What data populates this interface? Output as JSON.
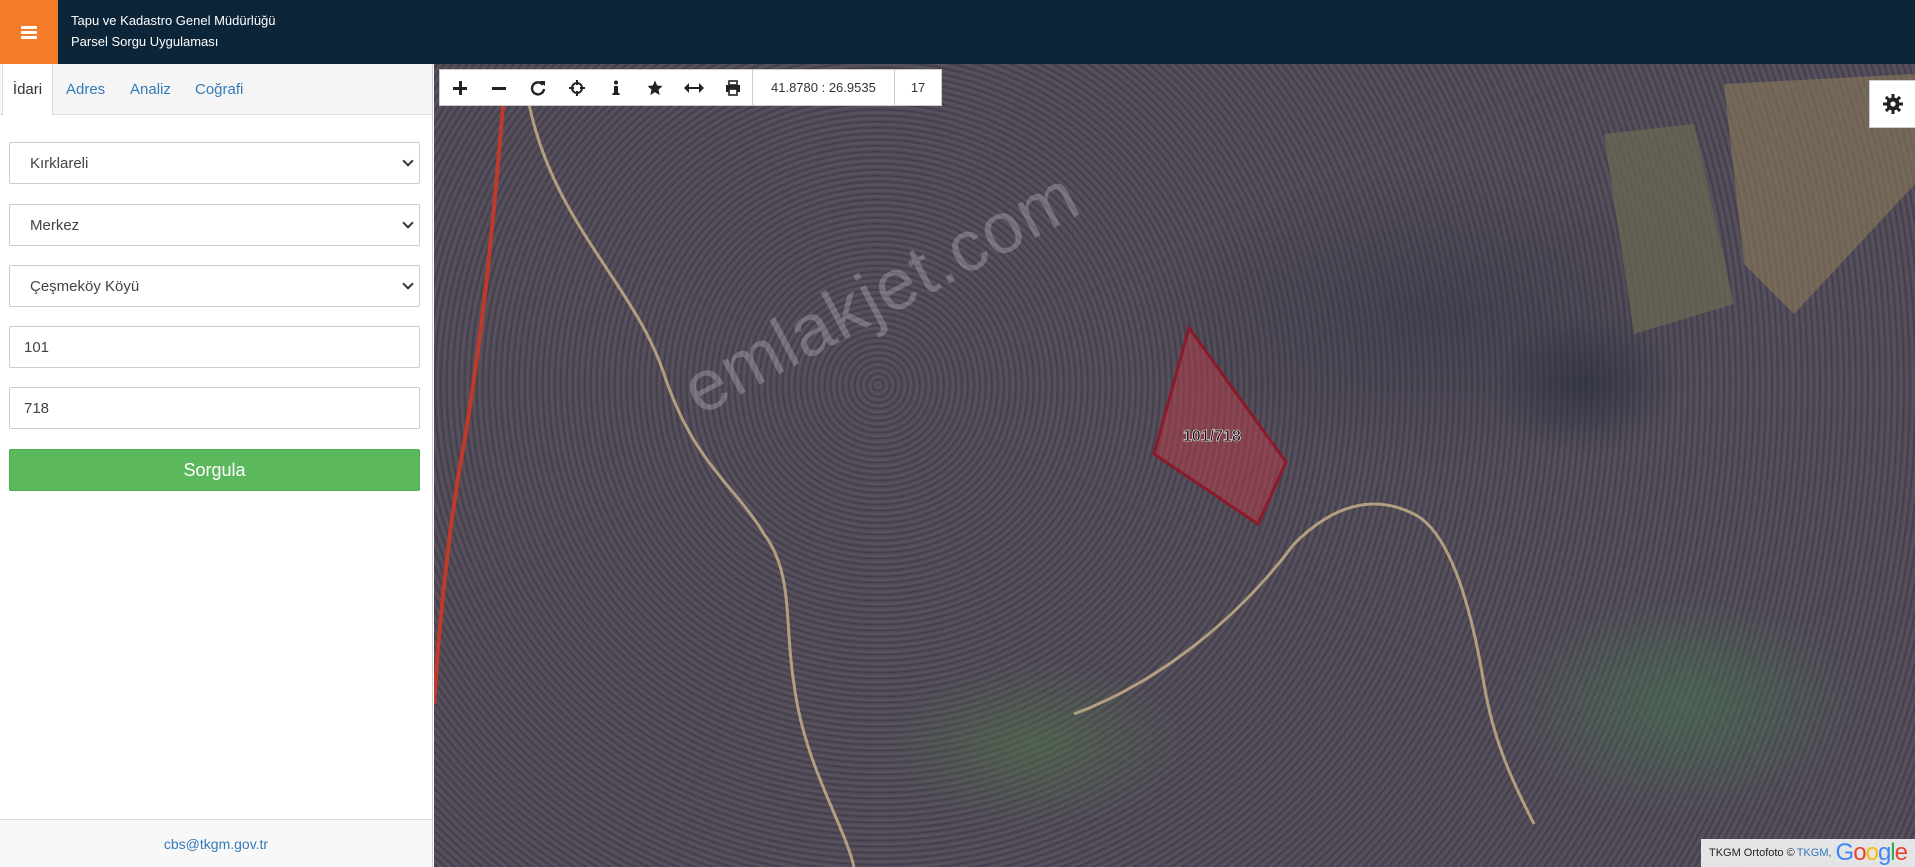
{
  "header": {
    "title_line1": "Tapu ve Kadastro Genel Müdürlüğü",
    "title_line2": "Parsel Sorgu Uygulaması"
  },
  "sidebar": {
    "tabs": [
      "İdari",
      "Adres",
      "Analiz",
      "Coğrafi"
    ],
    "active_tab": "İdari",
    "province": "Kırklareli",
    "district": "Merkez",
    "neighborhood": "Çeşmeköy Köyü",
    "block": "101",
    "parcel": "718",
    "query_button": "Sorgula",
    "footer_email": "cbs@tkgm.gov.tr"
  },
  "toolbar": {
    "icons": [
      "plus-icon",
      "minus-icon",
      "refresh-icon",
      "crosshair-icon",
      "info-icon",
      "star-icon",
      "measure-icon",
      "print-icon"
    ],
    "coordinates": "41.8780 : 26.9535",
    "zoom": "17"
  },
  "map": {
    "parcel_label": "101/718",
    "watermark": "emlakjet.com",
    "attribution_prefix": "TKGM Ortofoto ©",
    "attribution_link": "TKGM,",
    "attribution_brand": "Google"
  },
  "colors": {
    "header_bg": "#0c2538",
    "menu_bg": "#f57c2b",
    "query_button": "#5cb85c",
    "parcel_stroke": "#8b1a2a",
    "link": "#337ab7"
  }
}
